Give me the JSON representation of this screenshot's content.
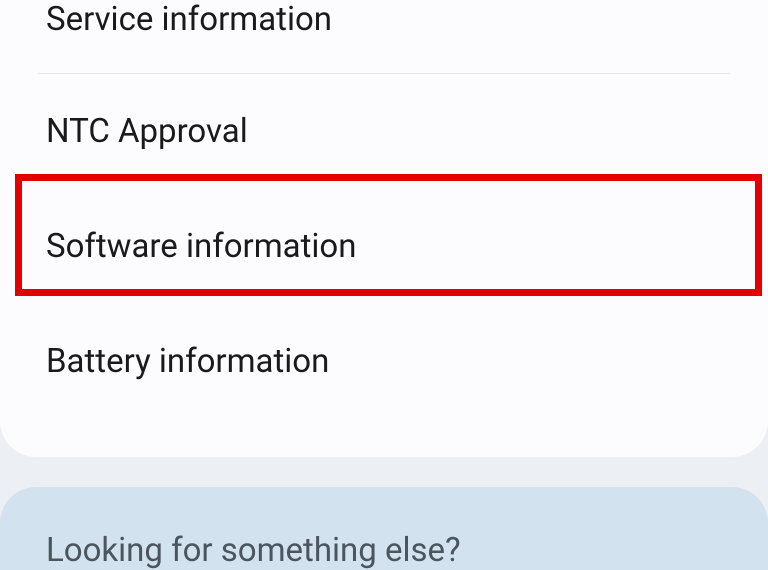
{
  "settings": {
    "items": [
      {
        "label": "Service information"
      },
      {
        "label": "NTC Approval"
      },
      {
        "label": "Software information"
      },
      {
        "label": "Battery information"
      }
    ]
  },
  "secondary": {
    "title": "Looking for something else?"
  }
}
